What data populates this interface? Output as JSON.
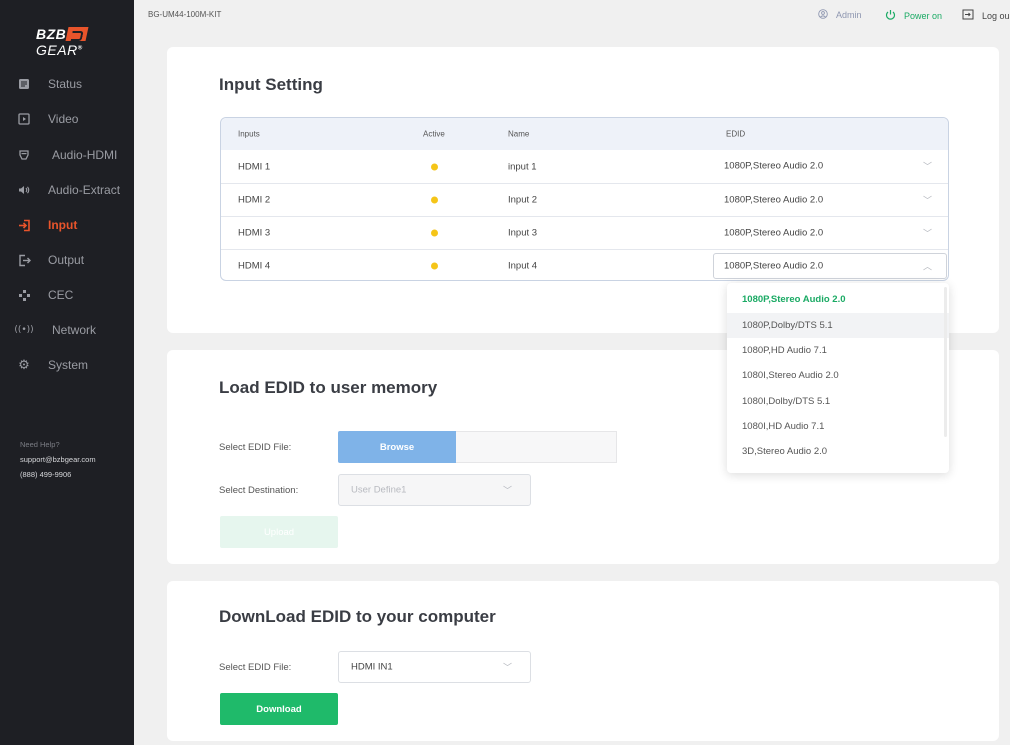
{
  "brand": {
    "logo_prefix": "BZB",
    "logo_suffix": "GEAR",
    "logo_mark": "®"
  },
  "sidebar": {
    "items": [
      {
        "label": "Status",
        "icon": "document-icon"
      },
      {
        "label": "Video",
        "icon": "video-icon"
      },
      {
        "label": "Audio-HDMI",
        "icon": "hdmi-icon"
      },
      {
        "label": "Audio-Extract",
        "icon": "speaker-icon"
      },
      {
        "label": "Input",
        "icon": "input-icon",
        "active": true
      },
      {
        "label": "Output",
        "icon": "output-icon"
      },
      {
        "label": "CEC",
        "icon": "cec-icon"
      },
      {
        "label": "Network",
        "icon": "network-icon"
      },
      {
        "label": "System",
        "icon": "gear-icon"
      }
    ],
    "help_title": "Need Help?",
    "help_email": "support@bzbgear.com",
    "help_phone": "(888) 499-9906"
  },
  "topbar": {
    "model": "BG-UM44-100M-KIT",
    "user": "Admin",
    "power": "Power on",
    "logout": "Log ou"
  },
  "input_setting": {
    "title": "Input Setting",
    "headers": {
      "inputs": "Inputs",
      "active": "Active",
      "name": "Name",
      "edid": "EDID"
    },
    "rows": [
      {
        "input": "HDMI 1",
        "name": "input 1",
        "edid": "1080P,Stereo Audio 2.0"
      },
      {
        "input": "HDMI 2",
        "name": "Input 2",
        "edid": "1080P,Stereo Audio 2.0"
      },
      {
        "input": "HDMI 3",
        "name": "Input 3",
        "edid": "1080P,Stereo Audio 2.0"
      },
      {
        "input": "HDMI 4",
        "name": "Input 4",
        "edid": "1080P,Stereo Audio 2.0"
      }
    ],
    "dropdown_options": [
      "1080P,Stereo Audio 2.0",
      "1080P,Dolby/DTS 5.1",
      "1080P,HD Audio 7.1",
      "1080I,Stereo Audio 2.0",
      "1080I,Dolby/DTS 5.1",
      "1080I,HD Audio 7.1",
      "3D,Stereo Audio 2.0"
    ]
  },
  "load_edid": {
    "title": "Load EDID to user memory",
    "file_label": "Select EDID File:",
    "browse_label": "Browse",
    "dest_label": "Select Destination:",
    "dest_value": "User Define1",
    "upload_label": "Upload"
  },
  "download_edid": {
    "title": "DownLoad EDID to your computer",
    "file_label": "Select EDID File:",
    "file_value": "HDMI IN1",
    "download_label": "Download"
  },
  "colors": {
    "accent": "#e8542b",
    "green": "#1fba6a",
    "blue": "#7fb3e8",
    "active_dot": "#f5c518"
  }
}
